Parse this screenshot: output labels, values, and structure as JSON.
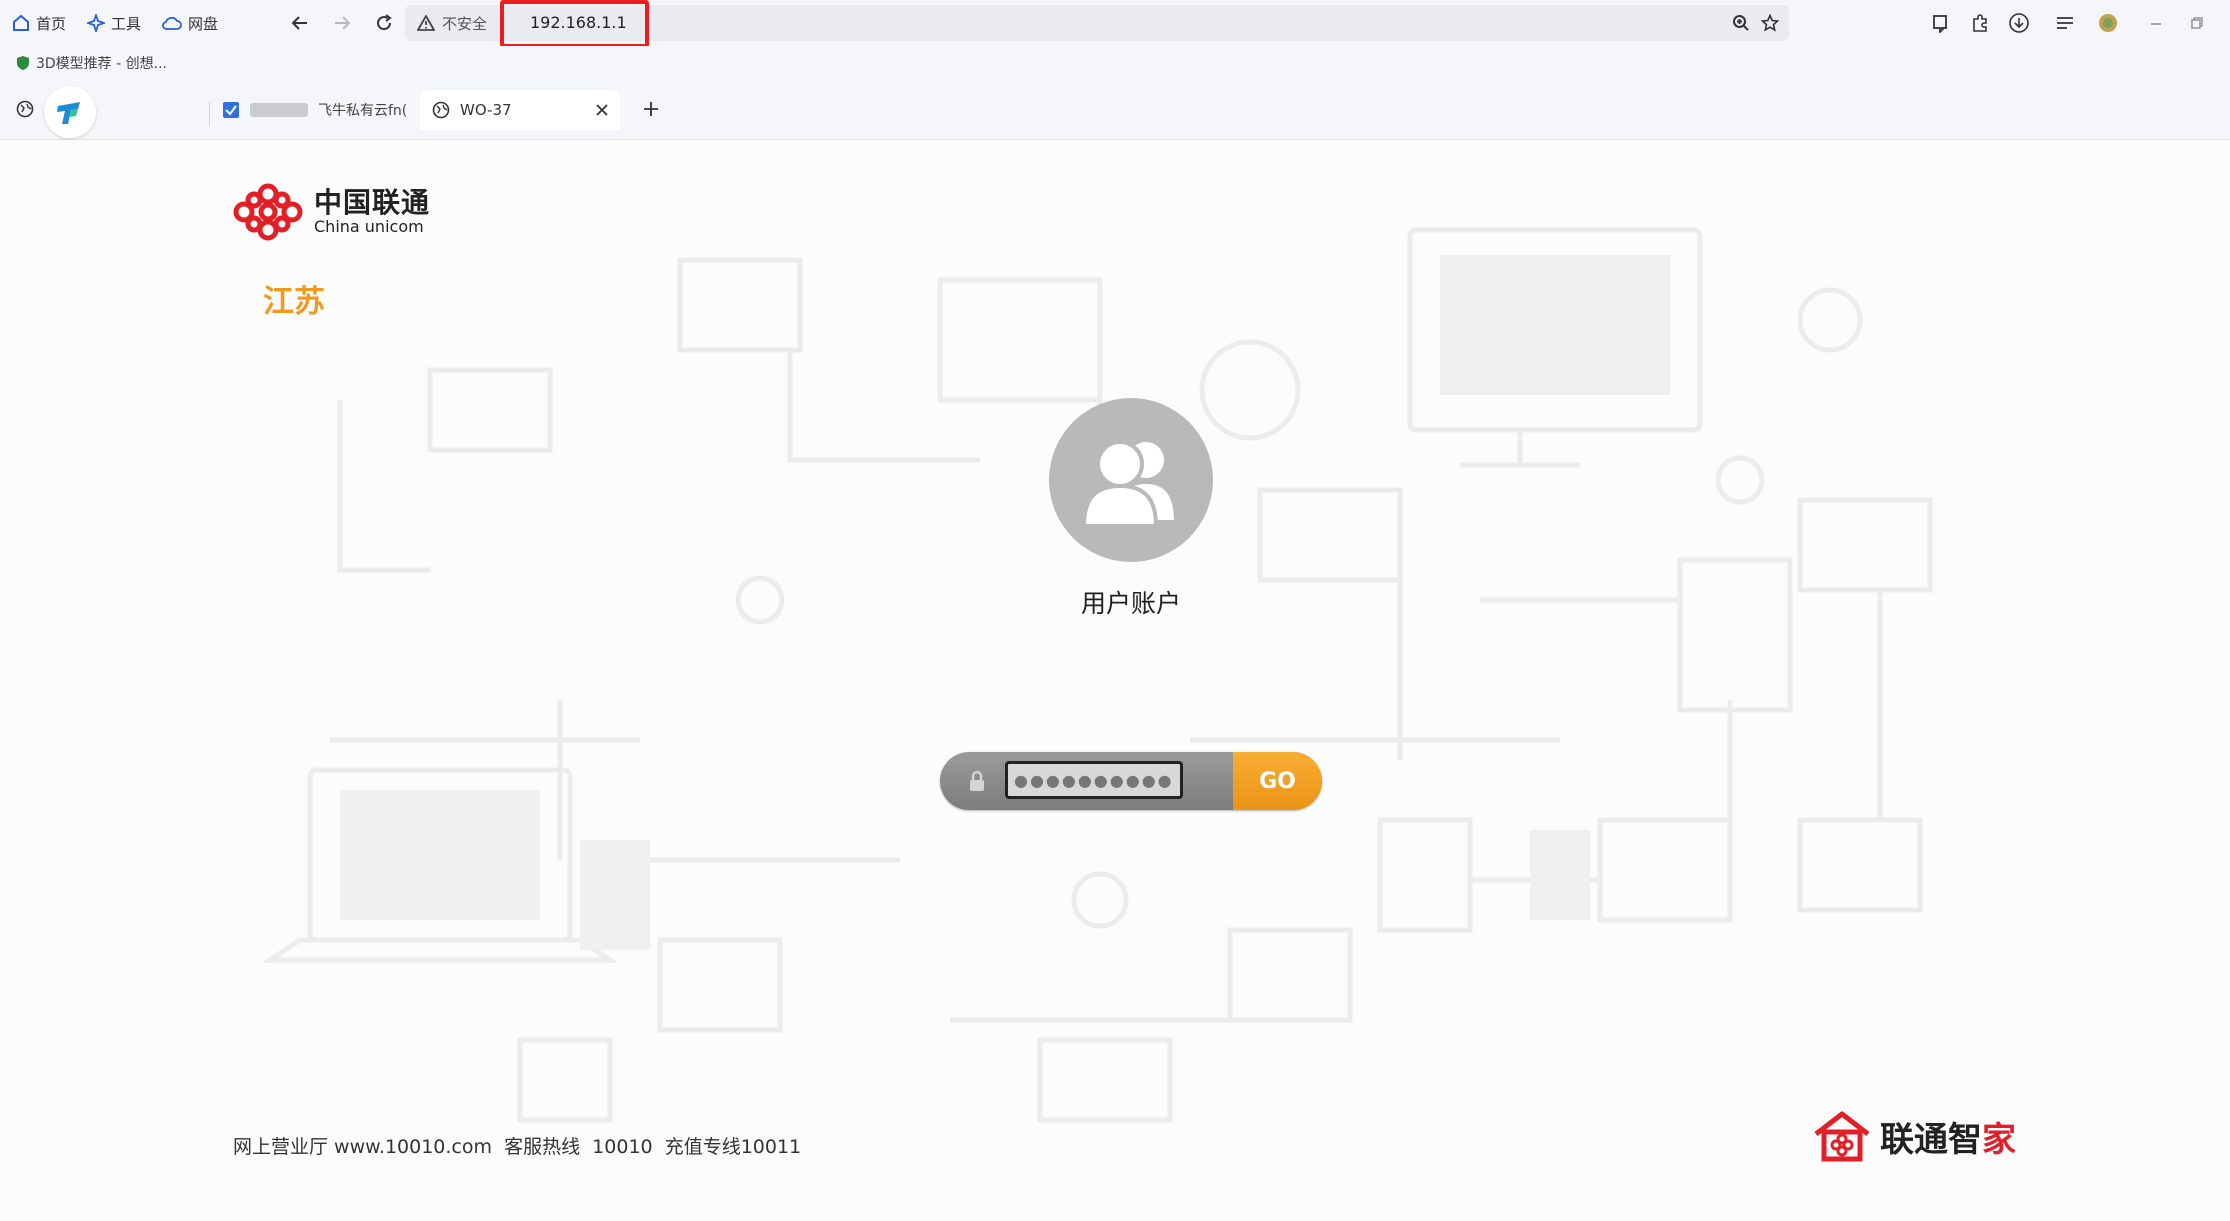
{
  "browser": {
    "nav_links": [
      {
        "label": "首页",
        "icon": "home-icon"
      },
      {
        "label": "工具",
        "icon": "sparkle-icon"
      },
      {
        "label": "网盘",
        "icon": "cloud-icon"
      }
    ],
    "address_bar": {
      "security_label": "不安全",
      "url": "192.168.1.1",
      "highlight_color": "#ef1c1c"
    },
    "bookmarks": [
      {
        "label": "3D模型推荐 - 创想...",
        "icon": "shield-icon"
      }
    ],
    "tabs": [
      {
        "title": "飞牛私有云fn(",
        "icon": "app-icon",
        "active": false
      },
      {
        "title": "WO-37",
        "icon": "globe-icon",
        "active": true
      }
    ]
  },
  "page": {
    "logo": {
      "cn": "中国联通",
      "en": "China unicom",
      "color": "#e21e26"
    },
    "province": "江苏",
    "account_label": "用户账户",
    "password": {
      "value": "●●●●●●●●●●●",
      "icon": "lock-icon"
    },
    "go_label": "GO",
    "footer": "网上营业厅 www.10010.com  客服热线  10010  充值专线10011",
    "brand": {
      "prefix": "联通智",
      "suffix": "家",
      "icon": "smart-home-icon"
    },
    "accent_color": "#f39a1e"
  }
}
